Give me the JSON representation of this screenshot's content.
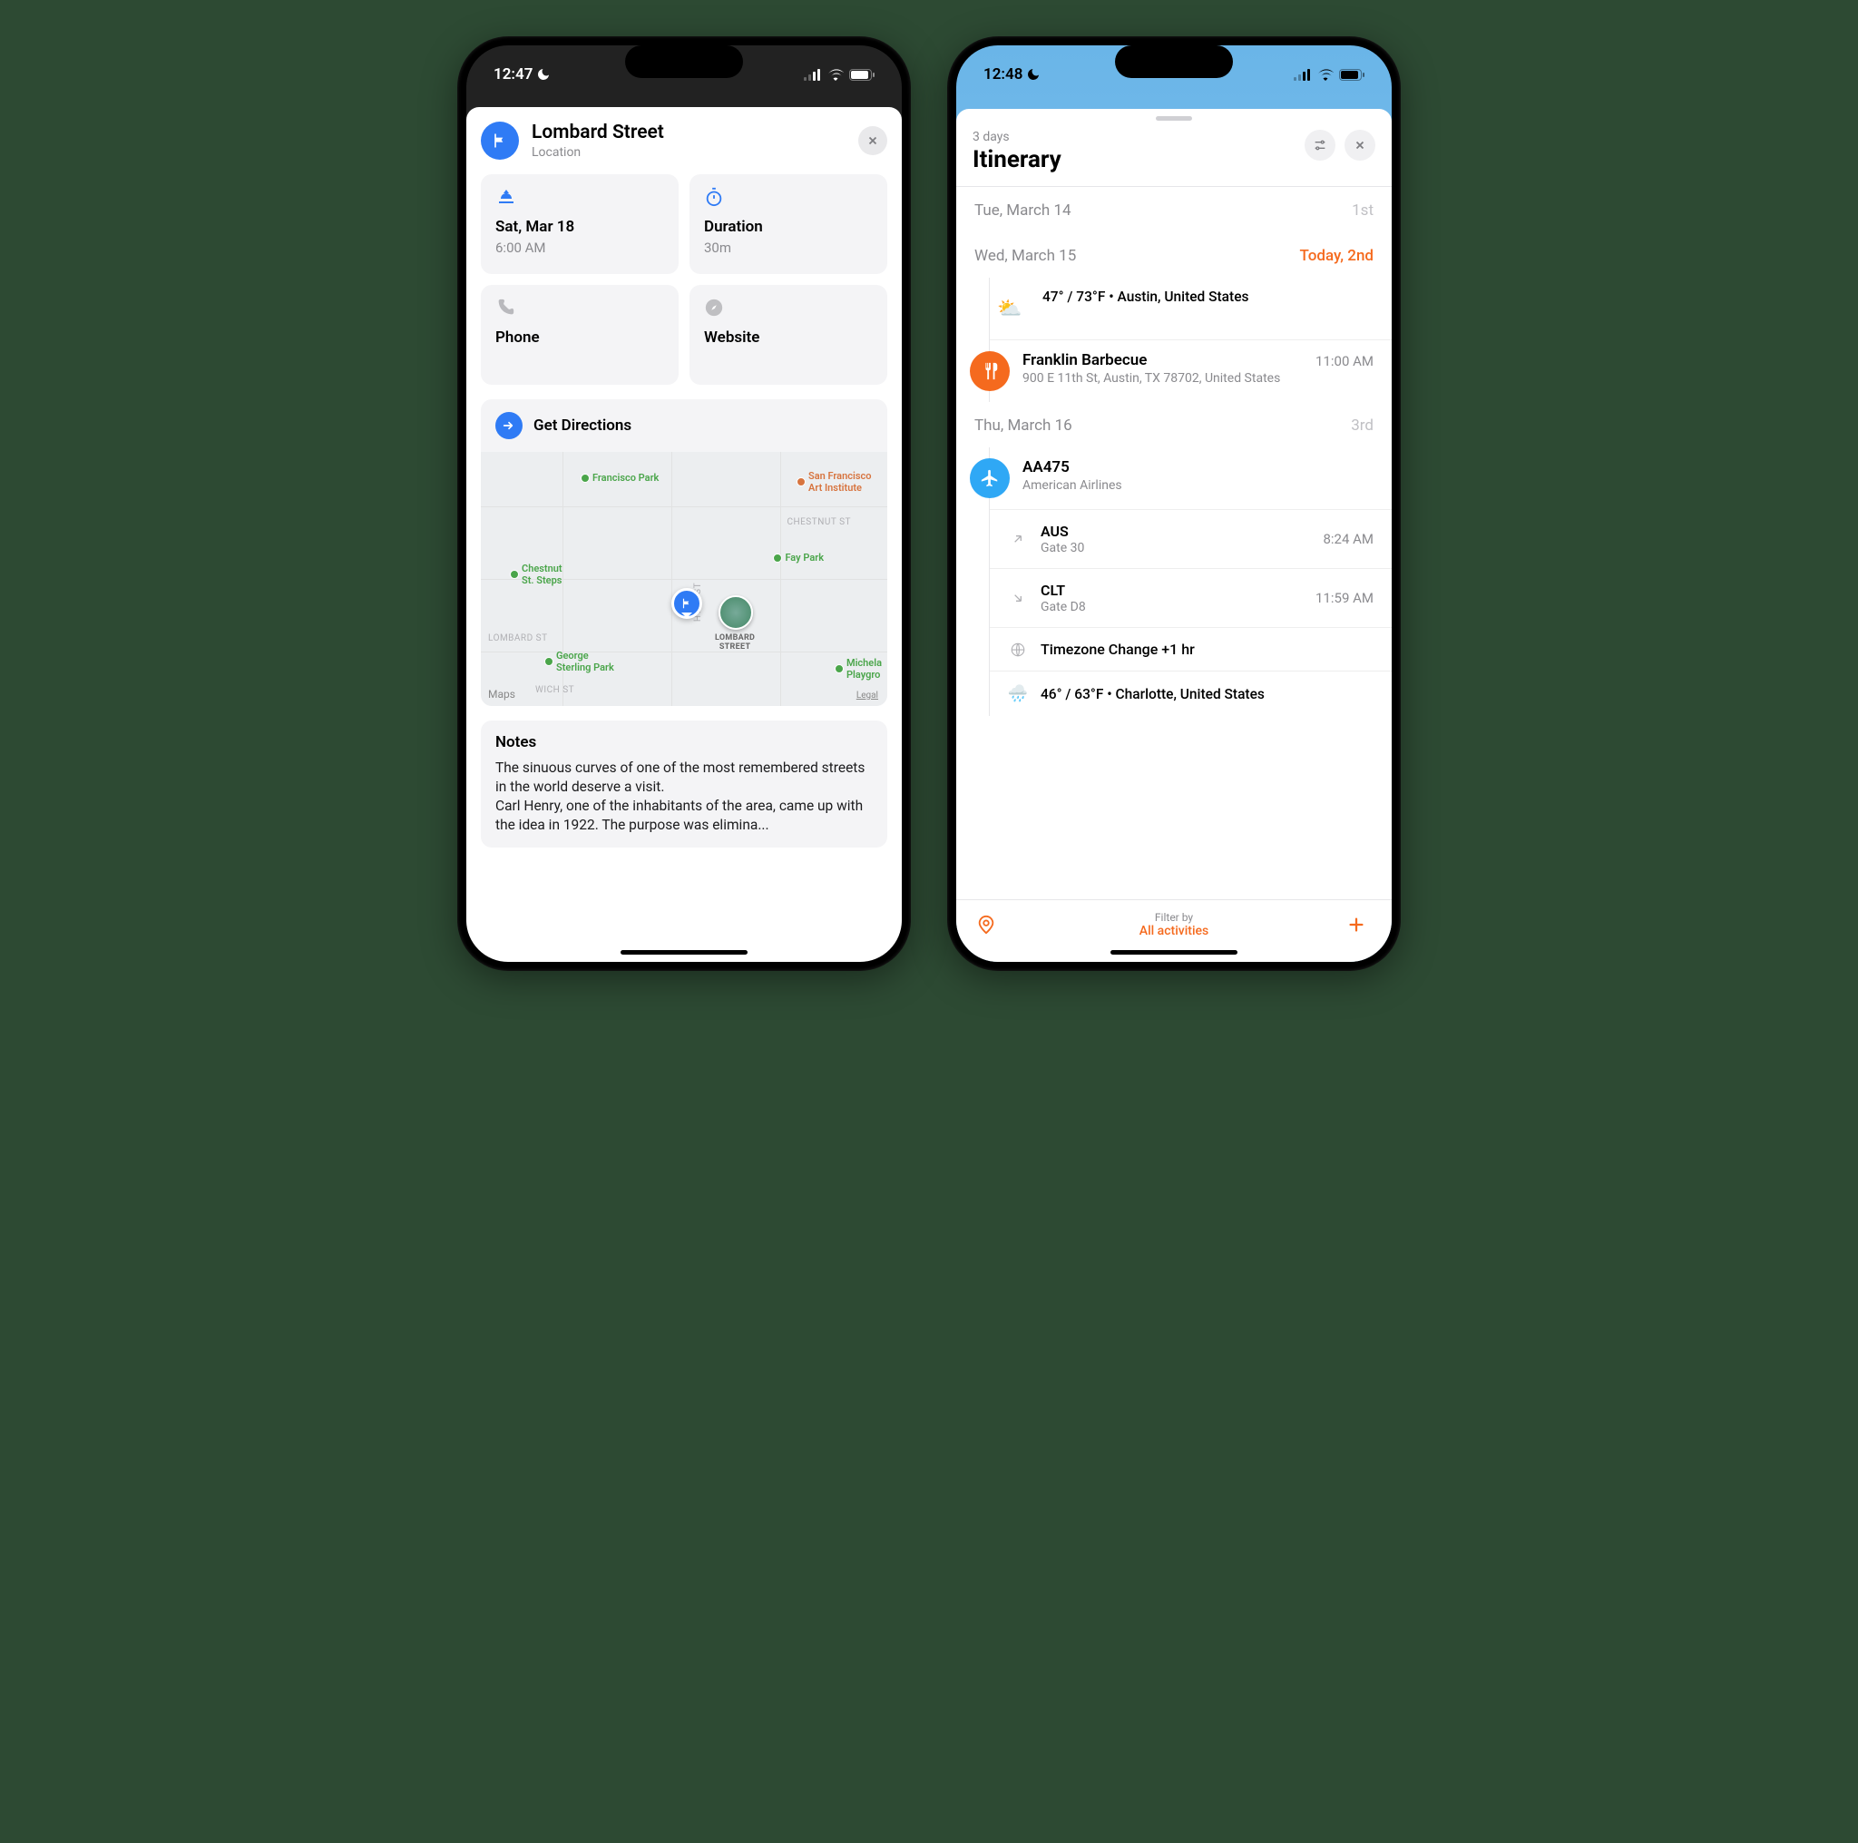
{
  "left": {
    "status": {
      "time": "12:47"
    },
    "title": "Lombard Street",
    "subtitle": "Location",
    "cards": {
      "date_title": "Sat, Mar 18",
      "date_sub": "6:00 AM",
      "dur_title": "Duration",
      "dur_sub": "30m",
      "phone_title": "Phone",
      "web_title": "Website"
    },
    "directions": "Get Directions",
    "map": {
      "brand": "Maps",
      "legal": "Legal",
      "poi_park": "Francisco Park",
      "poi_fay": "Fay Park",
      "poi_chestnut": "Chestnut\nSt. Steps",
      "poi_sterling": "George\nSterling Park",
      "poi_michel": "Michela\nPlaygro",
      "poi_sfai": "San Francisco\nArt Institute",
      "lbl_chestnut": "CHESTNUT ST",
      "lbl_lombard": "LOMBARD ST",
      "lbl_hyde": "HYDE ST",
      "lbl_wich": "WICH ST",
      "pin_label": "LOMBARD\nSTREET"
    },
    "notes": {
      "title": "Notes",
      "body": "The sinuous curves of one of the most remembered streets in the world deserve a visit.\nCarl Henry, one of the inhabitants of the area, came up with the idea in 1922. The purpose was elimina..."
    }
  },
  "right": {
    "status": {
      "time": "12:48"
    },
    "trip_len": "3 days",
    "title": "Itinerary",
    "days": {
      "d1_label": "Tue, March 14",
      "d1_pos": "1st",
      "d2_label": "Wed, March 15",
      "d2_pos": "Today, 2nd",
      "d3_label": "Thu, March 16",
      "d3_pos": "3rd"
    },
    "weather1": "47° / 73°F • Austin, United States",
    "act1": {
      "title": "Franklin Barbecue",
      "sub": "900 E 11th St, Austin, TX  78702, United States",
      "time": "11:00 AM"
    },
    "flight": {
      "title": "AA475",
      "sub": "American Airlines"
    },
    "dep": {
      "code": "AUS",
      "gate": "Gate 30",
      "time": "8:24 AM"
    },
    "arr": {
      "code": "CLT",
      "gate": "Gate D8",
      "time": "11:59 AM"
    },
    "tz": "Timezone Change +1 hr",
    "weather2": "46° / 63°F • Charlotte, United States",
    "filter_label": "Filter by",
    "filter_value": "All activities"
  }
}
